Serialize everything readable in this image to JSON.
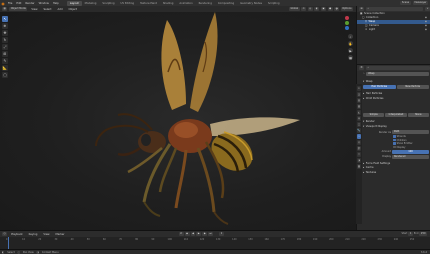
{
  "menu": [
    "File",
    "Edit",
    "Render",
    "Window",
    "Help"
  ],
  "workspaces": [
    "Layout",
    "Modeling",
    "Sculpting",
    "UV Editing",
    "Texture Paint",
    "Shading",
    "Animation",
    "Rendering",
    "Compositing",
    "Geometry Nodes",
    "Scripting"
  ],
  "active_workspace": "Layout",
  "scene_label": "Scene",
  "viewlayer_label": "ViewLayer",
  "viewport_header": {
    "mode": "Object Mode",
    "view": "View",
    "select": "Select",
    "add": "Add",
    "object": "Object",
    "global": "Global",
    "options": "Options"
  },
  "tools": [
    "cursor",
    "move",
    "rotate",
    "scale",
    "transform",
    "annotate",
    "measure",
    "add-cube"
  ],
  "outliner": {
    "title": "Scene Collection",
    "rows": [
      {
        "label": "Scene Collection",
        "indent": 0,
        "selected": false
      },
      {
        "label": "Collection",
        "indent": 1,
        "selected": false
      },
      {
        "label": "Wasp",
        "indent": 2,
        "selected": true
      },
      {
        "label": "Camera",
        "indent": 2,
        "selected": false
      },
      {
        "label": "Light",
        "indent": 2,
        "selected": false
      }
    ]
  },
  "properties": {
    "object_name": "Wasp",
    "sections": [
      "Wasp",
      "Hair Particles",
      "Child Particles",
      "Render",
      "Viewport Display",
      "Force Field Settings",
      "Cache",
      "Textures"
    ],
    "buttons": [
      "Hair Particles",
      "New Particle"
    ],
    "render_as_label": "Render As",
    "render_as_value": "Path",
    "checks": [
      "Strands",
      "Children",
      "Show Emitter",
      "Display"
    ],
    "amount_label": "Amount",
    "amount_value": "100",
    "display_label": "Display",
    "display_value": "Rendered"
  },
  "timeline": {
    "menu": [
      "Playback",
      "Keying",
      "View",
      "Marker"
    ],
    "frame": "1",
    "start_label": "Start",
    "start": "1",
    "end_label": "End",
    "end": "250",
    "ticks": [
      "0",
      "10",
      "20",
      "30",
      "40",
      "50",
      "60",
      "70",
      "80",
      "90",
      "100",
      "110",
      "120",
      "130",
      "140",
      "150",
      "160",
      "170",
      "180",
      "190",
      "200",
      "210",
      "220",
      "230",
      "240",
      "250"
    ]
  },
  "status": {
    "select": "Select",
    "pan_view": "Pan View",
    "context_menu": "Context Menu",
    "version": "3.6.2"
  },
  "colors": {
    "accent": "#4772b3",
    "logo": "#e87d0d",
    "selected_row": "#335a8e"
  }
}
